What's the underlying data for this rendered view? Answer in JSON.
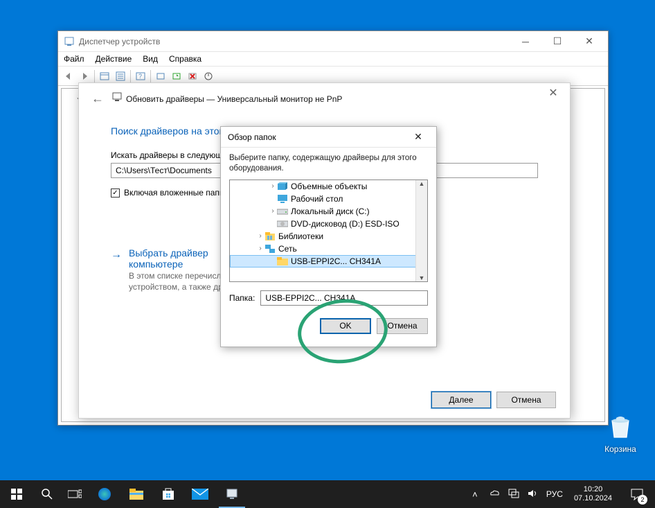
{
  "devmgr": {
    "title": "Диспетчер устройств",
    "menu": {
      "file": "Файл",
      "action": "Действие",
      "view": "Вид",
      "help": "Справка"
    }
  },
  "wizard": {
    "title": "Обновить драйверы — Универсальный монитор не PnP",
    "heading": "Поиск драйверов на этом",
    "search_label": "Искать драйверы в следующе",
    "path": "C:\\Users\\Тест\\Documents",
    "include_sub": "Включая вложенные папк",
    "link_title": "Выбрать драйвер",
    "link_line2": "компьютере",
    "link_desc1": "В этом списке перечисл",
    "link_desc2": "устройством, а также др",
    "next": "Далее",
    "cancel": "Отмена"
  },
  "browse": {
    "title": "Обзор папок",
    "desc": "Выберите папку, содержащую драйверы для этого оборудования.",
    "tree": [
      {
        "indent": 2,
        "expander": "›",
        "icon": "3d",
        "label": "Объемные объекты"
      },
      {
        "indent": 2,
        "expander": "",
        "icon": "desktop",
        "label": "Рабочий стол"
      },
      {
        "indent": 2,
        "expander": "›",
        "icon": "drive",
        "label": "Локальный диск (C:)"
      },
      {
        "indent": 2,
        "expander": "",
        "icon": "dvd",
        "label": "DVD-дисковод (D:) ESD-ISO"
      },
      {
        "indent": 1,
        "expander": "›",
        "icon": "lib",
        "label": "Библиотеки"
      },
      {
        "indent": 1,
        "expander": "›",
        "icon": "net",
        "label": "Сеть"
      },
      {
        "indent": 2,
        "expander": "",
        "icon": "folder",
        "label": "USB-EPPI2C... CH341A",
        "selected": true
      }
    ],
    "folder_label": "Папка:",
    "folder_value": "USB-EPPI2C... CH341A",
    "ok": "OK",
    "cancel": "Отмена"
  },
  "desktop": {
    "recycle": "Корзина"
  },
  "taskbar": {
    "lang": "РУС",
    "time": "10:20",
    "date": "07.10.2024",
    "notif_count": "2"
  }
}
